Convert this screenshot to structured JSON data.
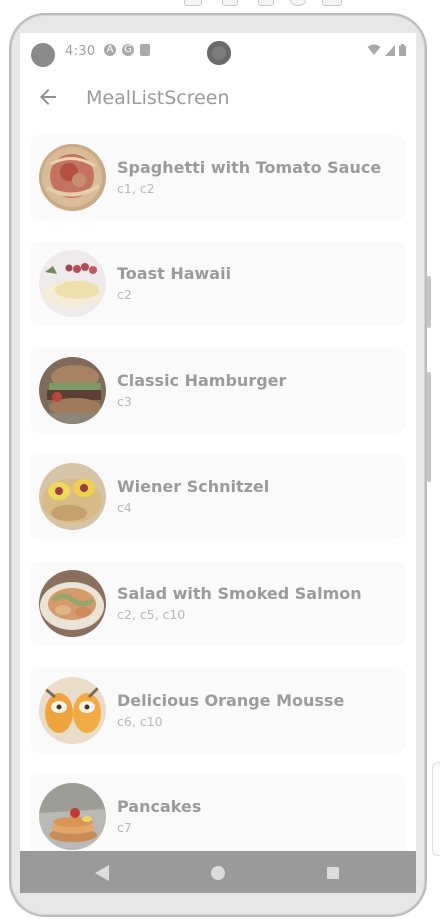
{
  "status_bar": {
    "time": "4:30",
    "left_icons": [
      "android-icon",
      "data-saver-icon",
      "sd-card-icon"
    ],
    "right_icons": [
      "wifi-icon",
      "signal-icon",
      "battery-icon"
    ]
  },
  "app_bar": {
    "title": "MealListScreen",
    "back_icon": "arrow-back-icon"
  },
  "meals": [
    {
      "name": "Spaghetti with Tomato Sauce",
      "categories": "c1, c2",
      "image": "spaghetti"
    },
    {
      "name": "Toast Hawaii",
      "categories": "c2",
      "image": "toast"
    },
    {
      "name": "Classic Hamburger",
      "categories": "c3",
      "image": "hamburger"
    },
    {
      "name": "Wiener Schnitzel",
      "categories": "c4",
      "image": "schnitzel"
    },
    {
      "name": "Salad with Smoked Salmon",
      "categories": "c2, c5, c10",
      "image": "salad"
    },
    {
      "name": "Delicious Orange Mousse",
      "categories": "c6, c10",
      "image": "mousse"
    },
    {
      "name": "Pancakes",
      "categories": "c7",
      "image": "pancakes"
    }
  ],
  "nav_bar": {
    "buttons": [
      "nav-back-icon",
      "nav-home-icon",
      "nav-recents-icon"
    ]
  },
  "colors": {
    "nav_bar": "#9a9a9a",
    "card_bg": "#fafafa",
    "title_text": "#9b9b9b",
    "subtitle_text": "#b9b9b9"
  }
}
